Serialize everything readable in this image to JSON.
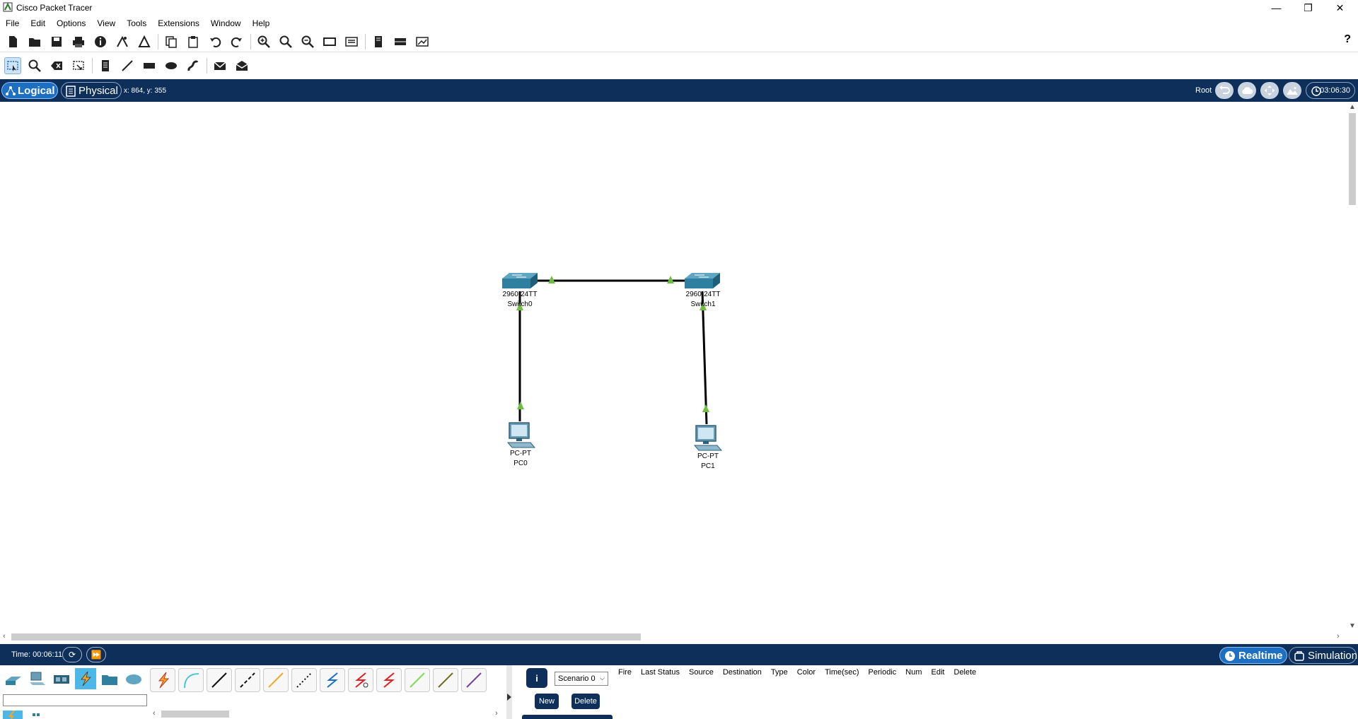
{
  "window": {
    "title": "Cisco Packet Tracer",
    "controls": [
      "—",
      "❐",
      "✕"
    ]
  },
  "menu": [
    "File",
    "Edit",
    "Options",
    "View",
    "Tools",
    "Extensions",
    "Window",
    "Help"
  ],
  "toolbar1": {
    "icons": [
      "new-file-icon",
      "open-icon",
      "save-icon",
      "print-icon",
      "info-icon",
      "network-wizard-icon",
      "activity-wizard-icon",
      "copy-icon",
      "paste-icon",
      "undo-icon",
      "redo-icon",
      "zoom-in-icon",
      "zoom-reset-icon",
      "zoom-out-icon",
      "drawing-palette-icon",
      "custom-devices-icon",
      "cluster-icon",
      "viewport-icon",
      "screenshot-icon"
    ],
    "help": "?"
  },
  "toolbar2": {
    "icons": [
      "select-icon",
      "inspect-icon",
      "delete-icon",
      "resize-icon",
      "note-icon",
      "line-icon",
      "rectangle-icon",
      "ellipse-icon",
      "freeform-icon",
      "simple-pdu-icon",
      "complex-pdu-icon"
    ]
  },
  "navbar": {
    "logical_label": "Logical",
    "physical_label": "Physical",
    "coords": "x: 864, y: 355",
    "root_label": "Root",
    "clock": "03:06:30"
  },
  "topology": {
    "switches": [
      {
        "model": "2960-24TT",
        "name": "Switch0"
      },
      {
        "model": "2960-24TT",
        "name": "Switch1"
      }
    ],
    "pcs": [
      {
        "model": "PC-PT",
        "name": "PC0"
      },
      {
        "model": "PC-PT",
        "name": "PC1"
      }
    ],
    "link_status_color": "#6fbf3f"
  },
  "timebar": {
    "time": "Time: 00:06:11",
    "realtime_label": "Realtime",
    "simulation_label": "Simulation"
  },
  "scenario": {
    "info_label": "i",
    "selected": "Scenario 0",
    "new_label": "New",
    "delete_label": "Delete"
  },
  "pdu_columns": [
    "Fire",
    "Last Status",
    "Source",
    "Destination",
    "Type",
    "Color",
    "Time(sec)",
    "Periodic",
    "Num",
    "Edit",
    "Delete"
  ],
  "colors": {
    "navy": "#0d2f5a",
    "accent": "#1d6fc1"
  }
}
